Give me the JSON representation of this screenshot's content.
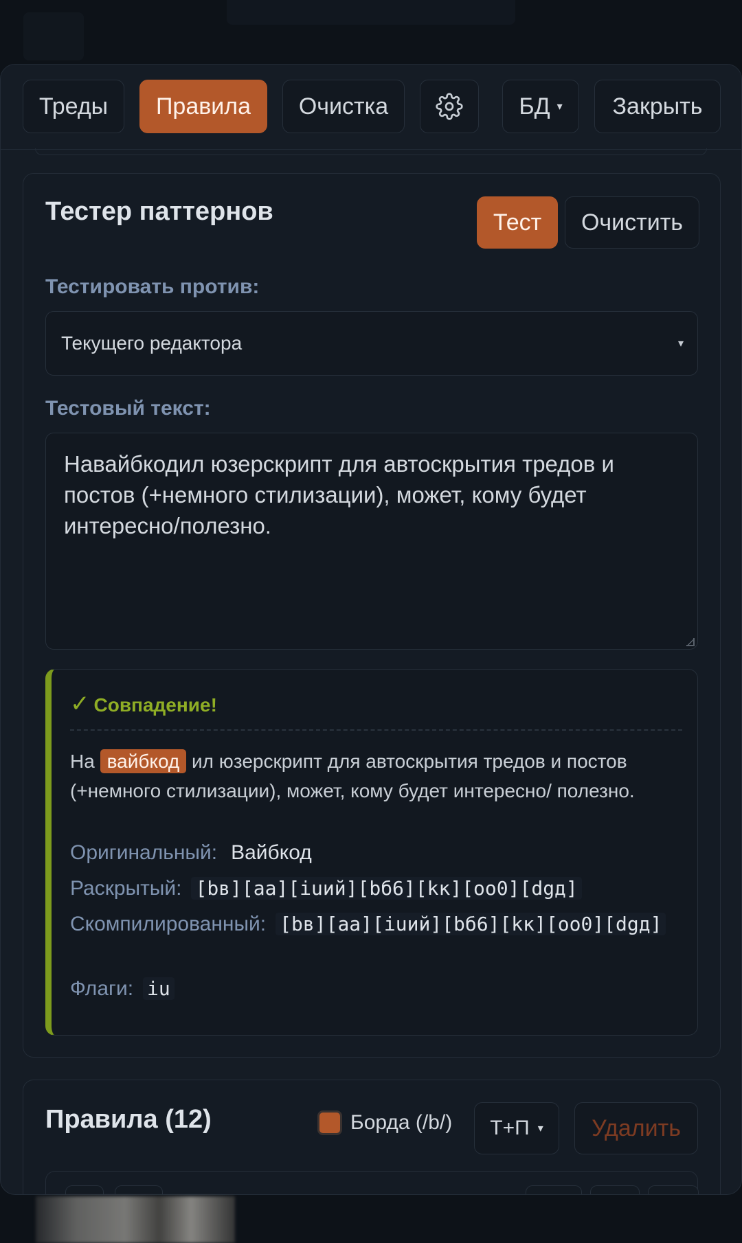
{
  "toolbar": {
    "threads": "Треды",
    "rules": "Правила",
    "cleanup": "Очистка",
    "settings_icon": "gear-icon",
    "db": "БД",
    "db_caret": "▾",
    "close": "Закрыть"
  },
  "tester": {
    "title": "Тестер паттернов",
    "test_button": "Тест",
    "clear_button": "Очистить",
    "against_label": "Тестировать против:",
    "against_value": "Текущего редактора",
    "select_caret": "▾",
    "text_label": "Тестовый текст:",
    "text_value": "Навайбкодил юзерскрипт для автоскрытия тредов и постов (+немного стилизации), может, кому будет интересно/полезно.",
    "result": {
      "check": "✓",
      "status": "Совпадение!",
      "before": "На",
      "match": "вайбкод",
      "after": "ил юзерскрипт для автоскрытия тредов и постов (+немного стилизации), может, кому будет интересно/ полезно.",
      "original_label": "Оригинальный:",
      "original_value": "Вайбкод",
      "expanded_label": "Раскрытый:",
      "expanded_value": "[bв][aа][iuий][bб6][kк][oо0][dgд]",
      "compiled_label": "Скомпилированный:",
      "compiled_value": "[bв][aа][iuий][bб6][kк][oо0][dgд]",
      "flags_label": "Флаги:",
      "flags_value": "iu"
    }
  },
  "rules": {
    "title": "Правила (12)",
    "board_label": "Борда (/b/)",
    "board_checked": true,
    "mode": "Т+П",
    "mode_caret": "▾",
    "delete_button": "Удалить"
  },
  "colors": {
    "accent": "#b3582a",
    "match_green": "#7d9b1d",
    "label_blue": "#7f93b0",
    "background": "#0d1218"
  }
}
